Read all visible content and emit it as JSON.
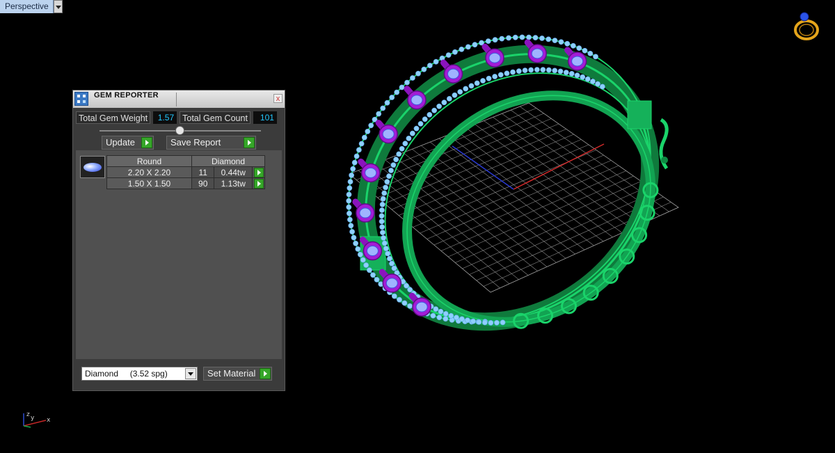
{
  "viewport": {
    "label": "Perspective"
  },
  "gem_reporter": {
    "title": "GEM REPORTER",
    "close_label": "x",
    "total_weight_label": "Total Gem Weight",
    "total_weight": "1.57",
    "total_count_label": "Total Gem Count",
    "total_count": "101",
    "update_label": "Update",
    "save_report_label": "Save Report",
    "table": {
      "shape": "Round",
      "material": "Diamond",
      "rows": [
        {
          "size": "2.20 X 2.20",
          "count": "11",
          "weight": "0.44tw"
        },
        {
          "size": "1.50 X 1.50",
          "count": "90",
          "weight": "1.13tw"
        }
      ]
    },
    "material_select": "Diamond     (3.52 spg)",
    "set_material_label": "Set Material"
  },
  "colors": {
    "ring_metal": "#1ad36a",
    "small_gems": "#8ecfff",
    "large_gems": "#a31cd6",
    "grid": "#9a9a9a"
  },
  "icons": {
    "ring_nav": "ring-icon",
    "axis": "axis-triad-icon"
  }
}
